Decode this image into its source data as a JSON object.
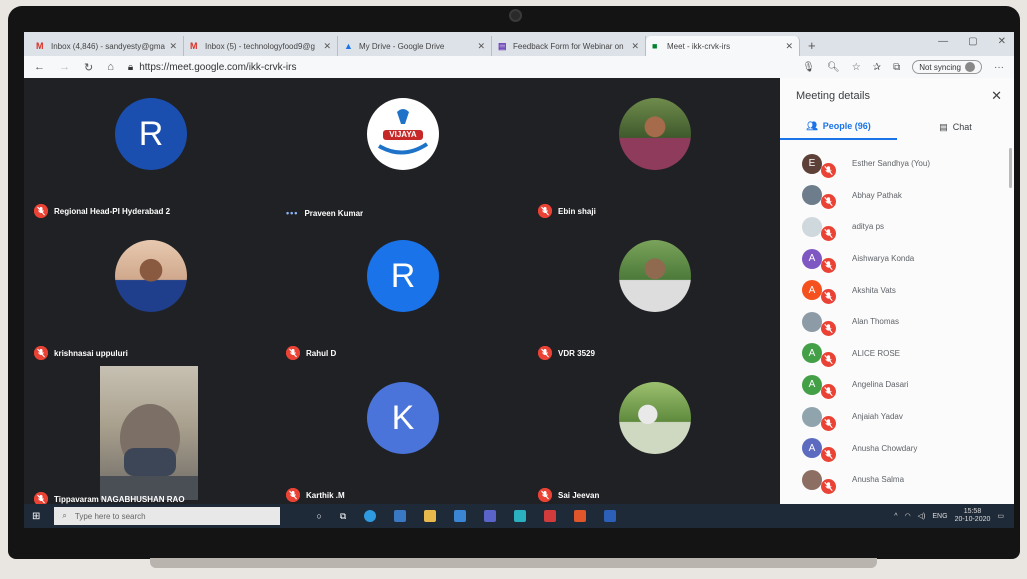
{
  "browser": {
    "tabs": [
      {
        "label": "Inbox (4,846) - sandyesty@gma",
        "fav": "M",
        "color": "#d93025",
        "active": false
      },
      {
        "label": "Inbox (5) - technologyfood9@g",
        "fav": "M",
        "color": "#d93025",
        "active": false
      },
      {
        "label": "My Drive - Google Drive",
        "fav": "▲",
        "color": "#1a73e8",
        "active": false
      },
      {
        "label": "Feedback Form for Webinar on",
        "fav": "▤",
        "color": "#673ab7",
        "active": false
      },
      {
        "label": "Meet - ikk-crvk-irs",
        "fav": "■",
        "color": "#00832d",
        "active": true
      }
    ],
    "url": "https://meet.google.com/ikk-crvk-irs",
    "sync_label": "Not syncing"
  },
  "tiles": [
    {
      "name": "Regional Head-PI Hyderabad 2",
      "type": "letter",
      "letter": "R",
      "color": "#1a4fb0",
      "muted": true
    },
    {
      "name": "Praveen Kumar",
      "type": "logo",
      "logo_text": "VIJAYA",
      "muted": false
    },
    {
      "name": "Ebin shaji",
      "type": "photo",
      "muted": true
    },
    {
      "name": "krishnasai uppuluri",
      "type": "photo",
      "muted": true
    },
    {
      "name": "Rahul D",
      "type": "letter",
      "letter": "R",
      "color": "#1a73e8",
      "muted": true
    },
    {
      "name": "VDR 3529",
      "type": "photo",
      "muted": true
    },
    {
      "name": "Tippavaram NAGABHUSHAN RAO",
      "type": "video",
      "muted": true
    },
    {
      "name": "Karthik .M",
      "type": "letter",
      "letter": "K",
      "color": "#4a74d9",
      "muted": true
    },
    {
      "name": "Sai Jeevan",
      "type": "photo",
      "muted": true
    }
  ],
  "panel": {
    "title": "Meeting details",
    "people_tab": "People (96)",
    "chat_tab": "Chat",
    "people": [
      {
        "name": "Esther Sandhya (You)",
        "initial": "E",
        "color": "#5d4037"
      },
      {
        "name": "Abhay Pathak",
        "initial": "",
        "color": "#6d7d8b"
      },
      {
        "name": "aditya ps",
        "initial": "",
        "color": "#cfd8dc"
      },
      {
        "name": "Aishwarya Konda",
        "initial": "A",
        "color": "#7e57c2"
      },
      {
        "name": "Akshita Vats",
        "initial": "A",
        "color": "#f4511e"
      },
      {
        "name": "Alan Thomas",
        "initial": "",
        "color": "#8d9ba7"
      },
      {
        "name": "ALICE ROSE",
        "initial": "A",
        "color": "#43a047"
      },
      {
        "name": "Angelina Dasari",
        "initial": "A",
        "color": "#43a047"
      },
      {
        "name": "Anjaiah Yadav",
        "initial": "",
        "color": "#90a4ae"
      },
      {
        "name": "Anusha Chowdary",
        "initial": "A",
        "color": "#5c6bc0"
      },
      {
        "name": "Anusha Salma",
        "initial": "",
        "color": "#8d6e63"
      }
    ]
  },
  "taskbar": {
    "search_placeholder": "Type here to search",
    "lang": "ENG",
    "time": "15:58",
    "date": "20-10-2020"
  }
}
